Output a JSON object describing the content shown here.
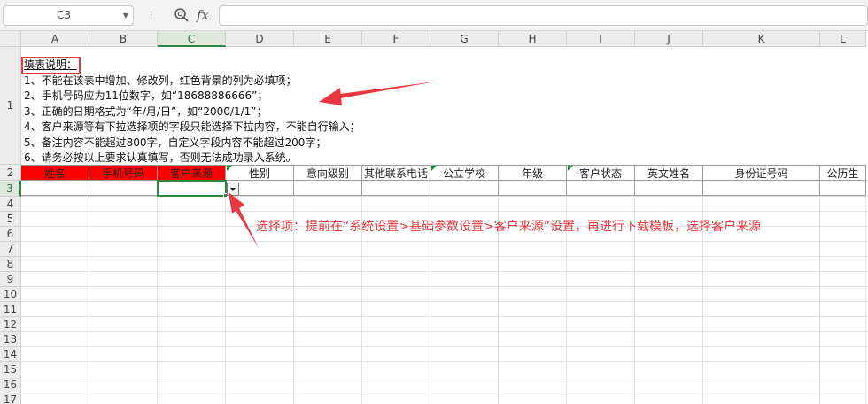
{
  "formula_bar": {
    "name_box": "C3",
    "zoom_icon": "zoom-icon",
    "fx_label": "fx",
    "formula": ""
  },
  "columns": [
    "A",
    "B",
    "C",
    "D",
    "E",
    "F",
    "G",
    "H",
    "I",
    "J",
    "K",
    "L"
  ],
  "rows": [
    "1",
    "2",
    "3",
    "4",
    "5",
    "6",
    "7",
    "8",
    "9",
    "10",
    "11",
    "12",
    "13",
    "14",
    "15",
    "16",
    "17"
  ],
  "active_cell": {
    "column": "C",
    "row": "3"
  },
  "instructions": {
    "title": "填表说明：",
    "lines": [
      "1、不能在该表中增加、修改列，红色背景的列为必填项；",
      "2、手机号码应为11位数字，如“18688886666”；",
      "3、正确的日期格式为“年/月/日”，如“2000/1/1”；",
      "4、客户来源等有下拉选择项的字段只能选择下拉内容，不能自行输入；",
      "5、备注内容不能超过800字，自定义字段内容不能超过200字；",
      "6、请务必按以上要求认真填写，否则无法成功录入系统。"
    ]
  },
  "headers": [
    {
      "label": "姓名",
      "required": true
    },
    {
      "label": "手机号码",
      "required": true
    },
    {
      "label": "客户来源",
      "required": true
    },
    {
      "label": "性别",
      "required": false
    },
    {
      "label": "意向级别",
      "required": false
    },
    {
      "label": "其他联系电话",
      "required": false
    },
    {
      "label": "公立学校",
      "required": false
    },
    {
      "label": "年级",
      "required": false
    },
    {
      "label": "客户状态",
      "required": false
    },
    {
      "label": "英文姓名",
      "required": false
    },
    {
      "label": "身份证号码",
      "required": false
    },
    {
      "label": "公历生",
      "required": false
    }
  ],
  "colors": {
    "required_bg": "#ff0000",
    "annotation": "#e8373e",
    "selection": "#2c8a3f"
  },
  "annotation": "选择项：提前在“系统设置>基础参数设置>客户来源”设置，再进行下载模板，选择客户来源"
}
